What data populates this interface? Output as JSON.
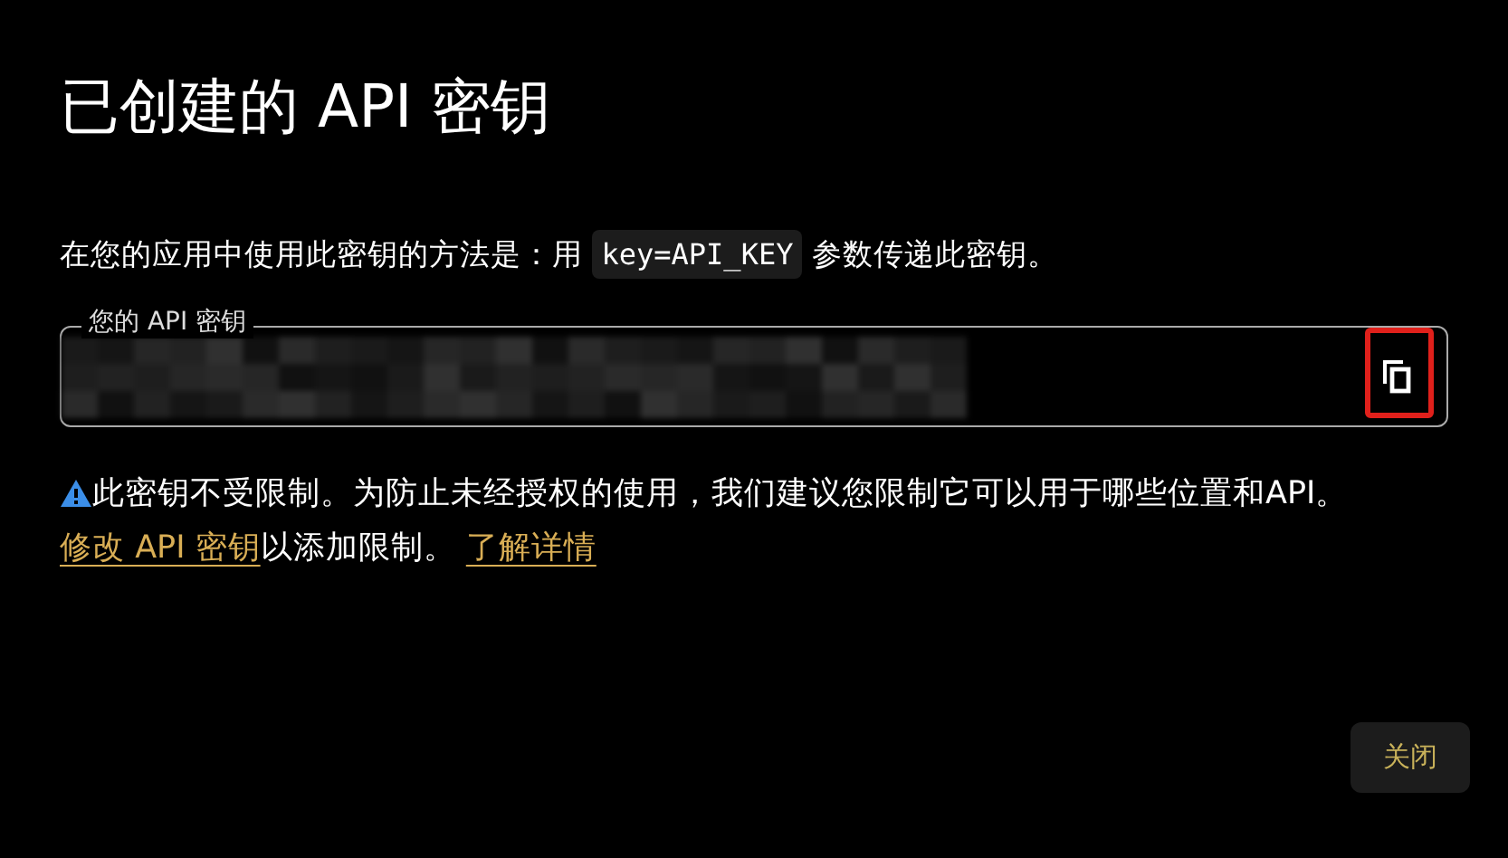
{
  "dialog": {
    "title": "已创建的 API 密钥",
    "description": [
      {
        "kind": "text",
        "text": "在您的应用中使用此密钥的方法是：用 "
      },
      {
        "kind": "code",
        "text": "key=API_KEY"
      },
      {
        "kind": "text",
        "text": " 参数传递此密钥。"
      }
    ],
    "key_field": {
      "label": "您的 API 密钥",
      "value": {
        "kind": "redacted"
      },
      "copy_button": {
        "highlighted": true
      }
    },
    "warning": [
      {
        "kind": "text",
        "text": "此密钥不受限制。为防止未经授权的使用，我们建议您限制它可以用于哪些位置和API。 "
      },
      {
        "kind": "link",
        "text": "修改 API 密钥"
      },
      {
        "kind": "text",
        "text": "以添加限制。 "
      },
      {
        "kind": "link",
        "text": "了解详情"
      }
    ],
    "buttons": [
      {
        "label": "关闭"
      }
    ]
  }
}
